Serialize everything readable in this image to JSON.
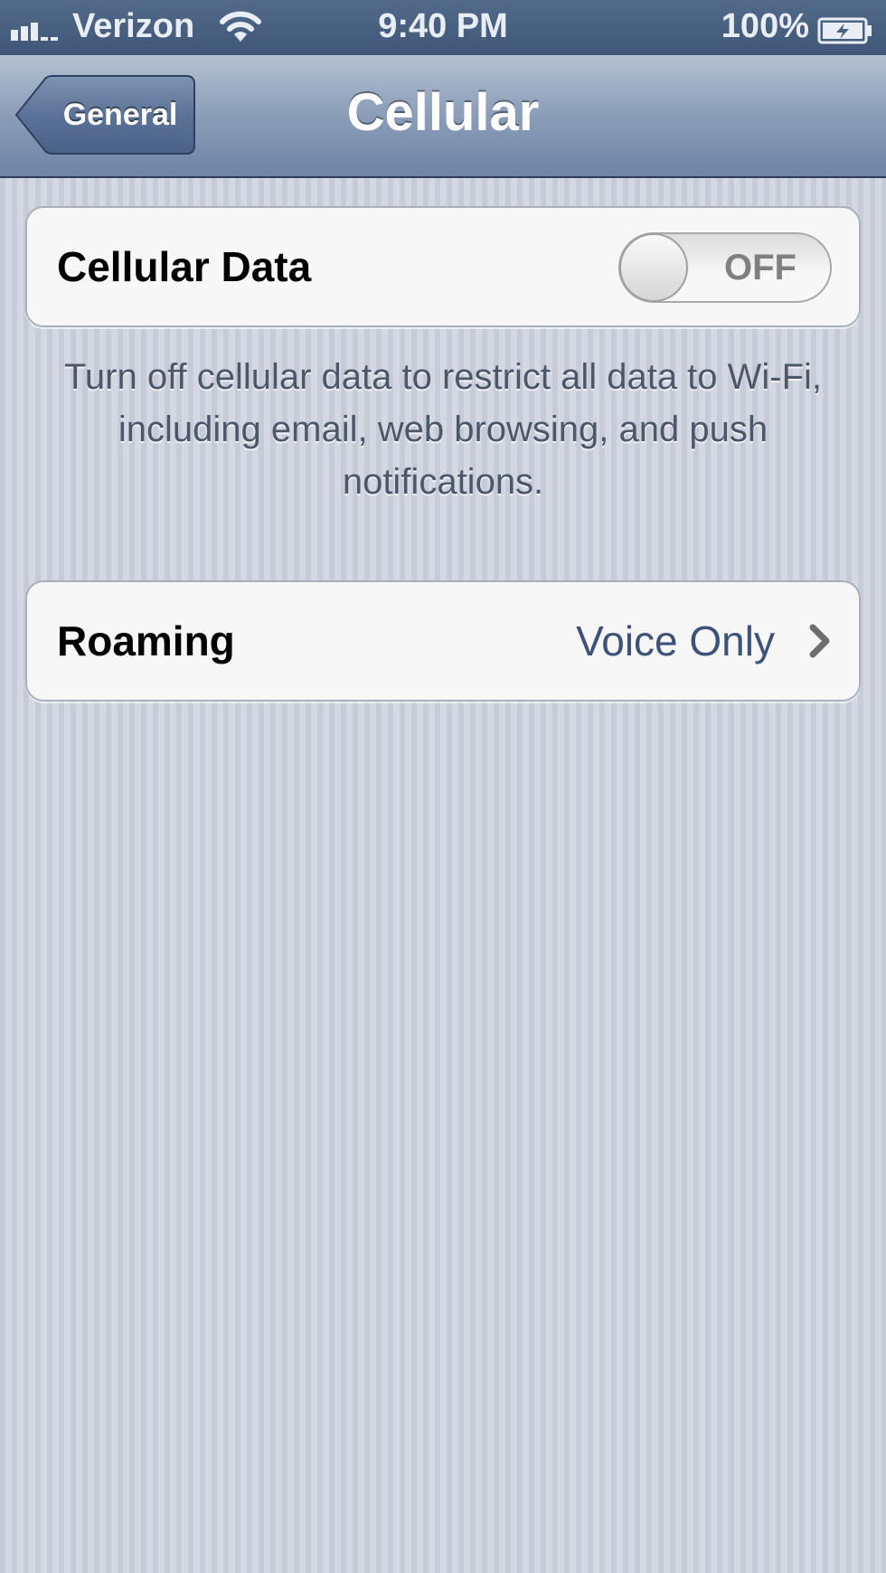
{
  "status_bar": {
    "carrier": "Verizon",
    "time": "9:40 PM",
    "battery": "100%"
  },
  "nav_bar": {
    "back_label": "General",
    "title": "Cellular"
  },
  "cellular_data": {
    "label": "Cellular Data",
    "toggle_state": "OFF",
    "footer": "Turn off cellular data to restrict all data to Wi-Fi, including email, web browsing, and push notifications."
  },
  "roaming": {
    "label": "Roaming",
    "value": "Voice Only"
  },
  "icons": [
    "signal-icon",
    "wifi-icon",
    "battery-icon",
    "chevron-right-icon"
  ],
  "colors": {
    "nav_bar": "#7a8fae",
    "detail_text": "#3e5279",
    "background": "#cbd1dc"
  }
}
